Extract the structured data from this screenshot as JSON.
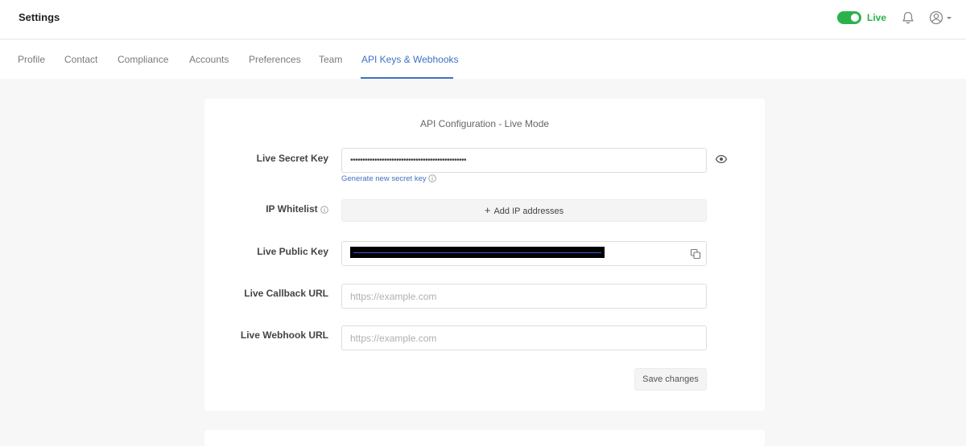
{
  "header": {
    "title": "Settings",
    "live_label": "Live",
    "live_on": true,
    "accent_color": "#2bb24c"
  },
  "tabs": [
    {
      "label": "Profile"
    },
    {
      "label": "Contact"
    },
    {
      "label": "Compliance"
    },
    {
      "label": "Accounts"
    },
    {
      "label": "Preferences"
    },
    {
      "label": "Team"
    },
    {
      "label": "API Keys & Webhooks",
      "active": true
    }
  ],
  "card": {
    "title": "API Configuration - Live Mode",
    "secret_key": {
      "label": "Live Secret Key",
      "value": "••••••••••••••••••••••••••••••••••••••••••••••••",
      "generate_link": "Generate new secret key"
    },
    "ip_whitelist": {
      "label": "IP Whitelist",
      "button": "Add IP addresses"
    },
    "public_key": {
      "label": "Live Public Key"
    },
    "callback_url": {
      "label": "Live Callback URL",
      "placeholder": "https://example.com"
    },
    "webhook_url": {
      "label": "Live Webhook URL",
      "placeholder": "https://example.com"
    },
    "save_button": "Save changes"
  },
  "icons": {
    "bell": "bell-icon",
    "user": "user-circle-icon",
    "eye": "eye-icon",
    "copy": "copy-icon",
    "info": "info-icon"
  }
}
